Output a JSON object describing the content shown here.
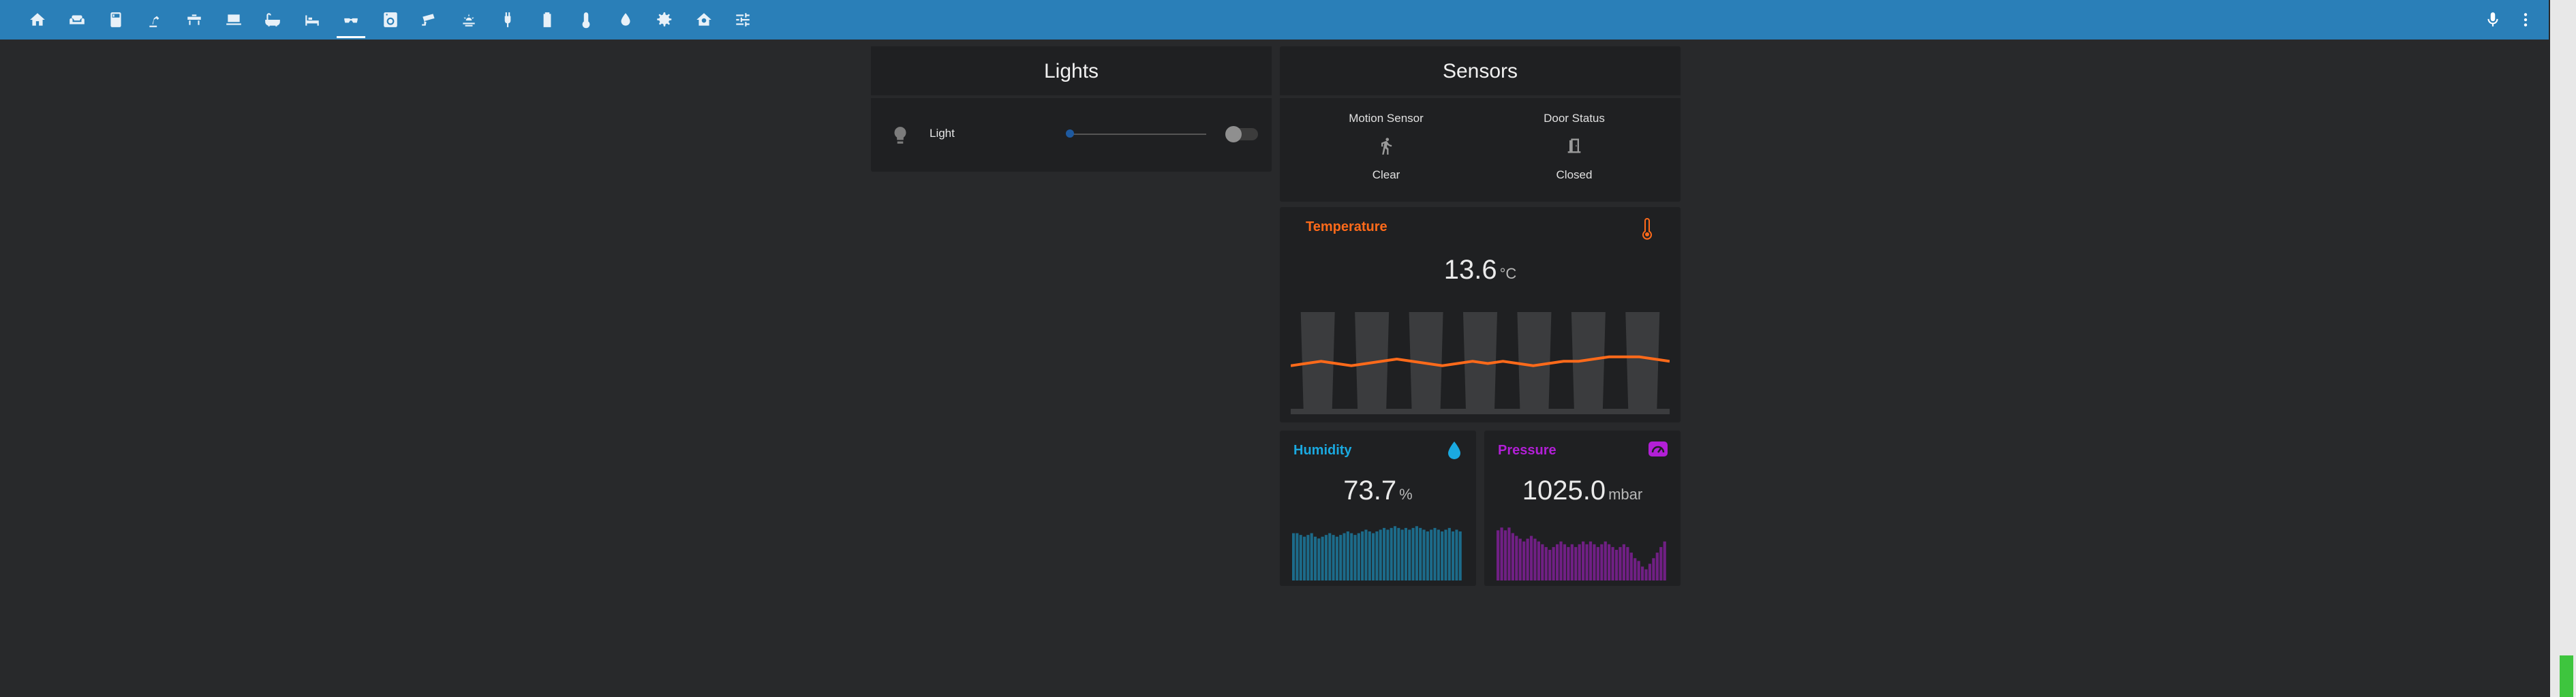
{
  "toolbar": {
    "tabs": [
      {
        "icon": "home-icon"
      },
      {
        "icon": "sofa-icon"
      },
      {
        "icon": "fridge-icon"
      },
      {
        "icon": "desk-lamp-icon"
      },
      {
        "icon": "washing-bench-icon"
      },
      {
        "icon": "laptop-icon"
      },
      {
        "icon": "bathtub-icon"
      },
      {
        "icon": "bed-icon"
      },
      {
        "icon": "sunglasses-icon"
      },
      {
        "icon": "washing-machine-icon"
      },
      {
        "icon": "cctv-icon"
      },
      {
        "icon": "weather-icon"
      },
      {
        "icon": "power-plug-icon"
      },
      {
        "icon": "battery-icon"
      },
      {
        "icon": "thermometer-icon"
      },
      {
        "icon": "water-icon"
      },
      {
        "icon": "settings-icon"
      },
      {
        "icon": "home-automation-icon"
      },
      {
        "icon": "tune-icon"
      }
    ],
    "active_tab": 8,
    "right_icons": [
      "microphone-icon",
      "more-vertical-icon"
    ]
  },
  "lights": {
    "title": "Lights",
    "entity_name": "Light",
    "brightness_fraction": 0.0,
    "state_on": false
  },
  "sensors": {
    "title": "Sensors",
    "motion": {
      "name": "Motion Sensor",
      "state": "Clear"
    },
    "door": {
      "name": "Door Status",
      "state": "Closed"
    }
  },
  "temperature": {
    "title": "Temperature",
    "value": "13.6",
    "unit": "°C",
    "color": "#ff6a1a",
    "series": [
      13.2,
      13.3,
      13.4,
      13.3,
      13.2,
      13.3,
      13.4,
      13.5,
      13.4,
      13.3,
      13.2,
      13.3,
      13.4,
      13.3,
      13.4,
      13.3,
      13.2,
      13.3,
      13.4,
      13.4,
      13.5,
      13.6,
      13.6,
      13.6,
      13.5,
      13.4
    ]
  },
  "humidity": {
    "title": "Humidity",
    "value": "73.7",
    "unit": "%",
    "color": "#1aa9e0",
    "series": [
      72,
      72,
      71,
      70,
      71,
      72,
      70,
      69,
      70,
      71,
      72,
      71,
      70,
      71,
      72,
      73,
      72,
      71,
      72,
      73,
      74,
      73,
      72,
      73,
      74,
      75,
      74,
      75,
      76,
      75,
      74,
      75,
      74,
      75,
      76,
      75,
      74,
      73,
      74,
      75,
      74,
      73,
      74,
      75,
      73,
      74,
      73
    ]
  },
  "pressure": {
    "title": "Pressure",
    "value": "1025.0",
    "unit": "mbar",
    "color": "#b21fd6",
    "series": [
      1030,
      1031,
      1030,
      1031,
      1029,
      1028,
      1027,
      1026,
      1027,
      1028,
      1027,
      1026,
      1025,
      1024,
      1023,
      1024,
      1025,
      1026,
      1025,
      1024,
      1025,
      1024,
      1025,
      1026,
      1025,
      1026,
      1025,
      1024,
      1025,
      1026,
      1025,
      1024,
      1023,
      1024,
      1025,
      1024,
      1022,
      1020,
      1019,
      1017,
      1016,
      1018,
      1020,
      1022,
      1024,
      1026
    ]
  }
}
